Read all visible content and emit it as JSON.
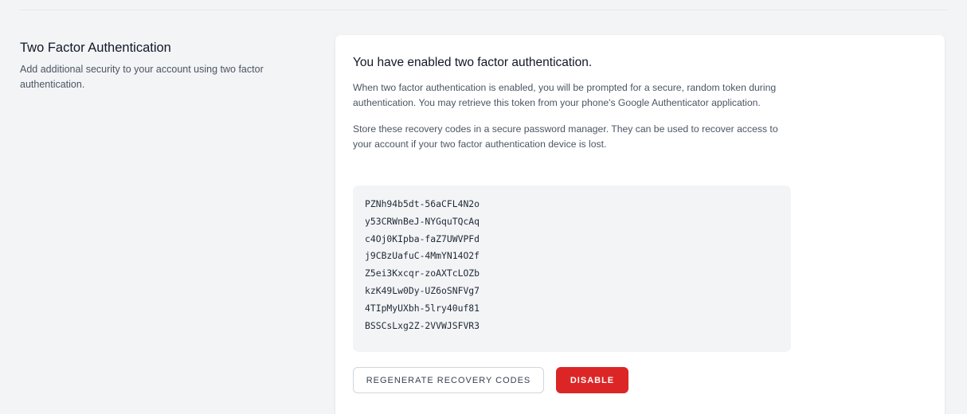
{
  "section": {
    "title": "Two Factor Authentication",
    "description": "Add additional security to your account using two factor authentication."
  },
  "card": {
    "title": "You have enabled two factor authentication.",
    "prompt_text": "When two factor authentication is enabled, you will be prompted for a secure, random token during authentication. You may retrieve this token from your phone's Google Authenticator application.",
    "recovery_text": "Store these recovery codes in a secure password manager. They can be used to recover access to your account if your two factor authentication device is lost.",
    "recovery_codes": [
      "PZNh94b5dt-56aCFL4N2o",
      "y53CRWnBeJ-NYGquTQcAq",
      "c4Oj0KIpba-faZ7UWVPFd",
      "j9CBzUafuC-4MmYN14O2f",
      "Z5ei3Kxcqr-zoAXTcLOZb",
      "kzK49Lw0Dy-UZ6oSNFVg7",
      "4TIpMyUXbh-5lry40uf81",
      "BSSCsLxg2Z-2VVWJSFVR3"
    ],
    "regenerate_label": "Regenerate Recovery Codes",
    "disable_label": "Disable"
  },
  "colors": {
    "danger": "#dc2626",
    "codes_background": "#f3f4f6",
    "page_background": "#f3f4f6"
  }
}
